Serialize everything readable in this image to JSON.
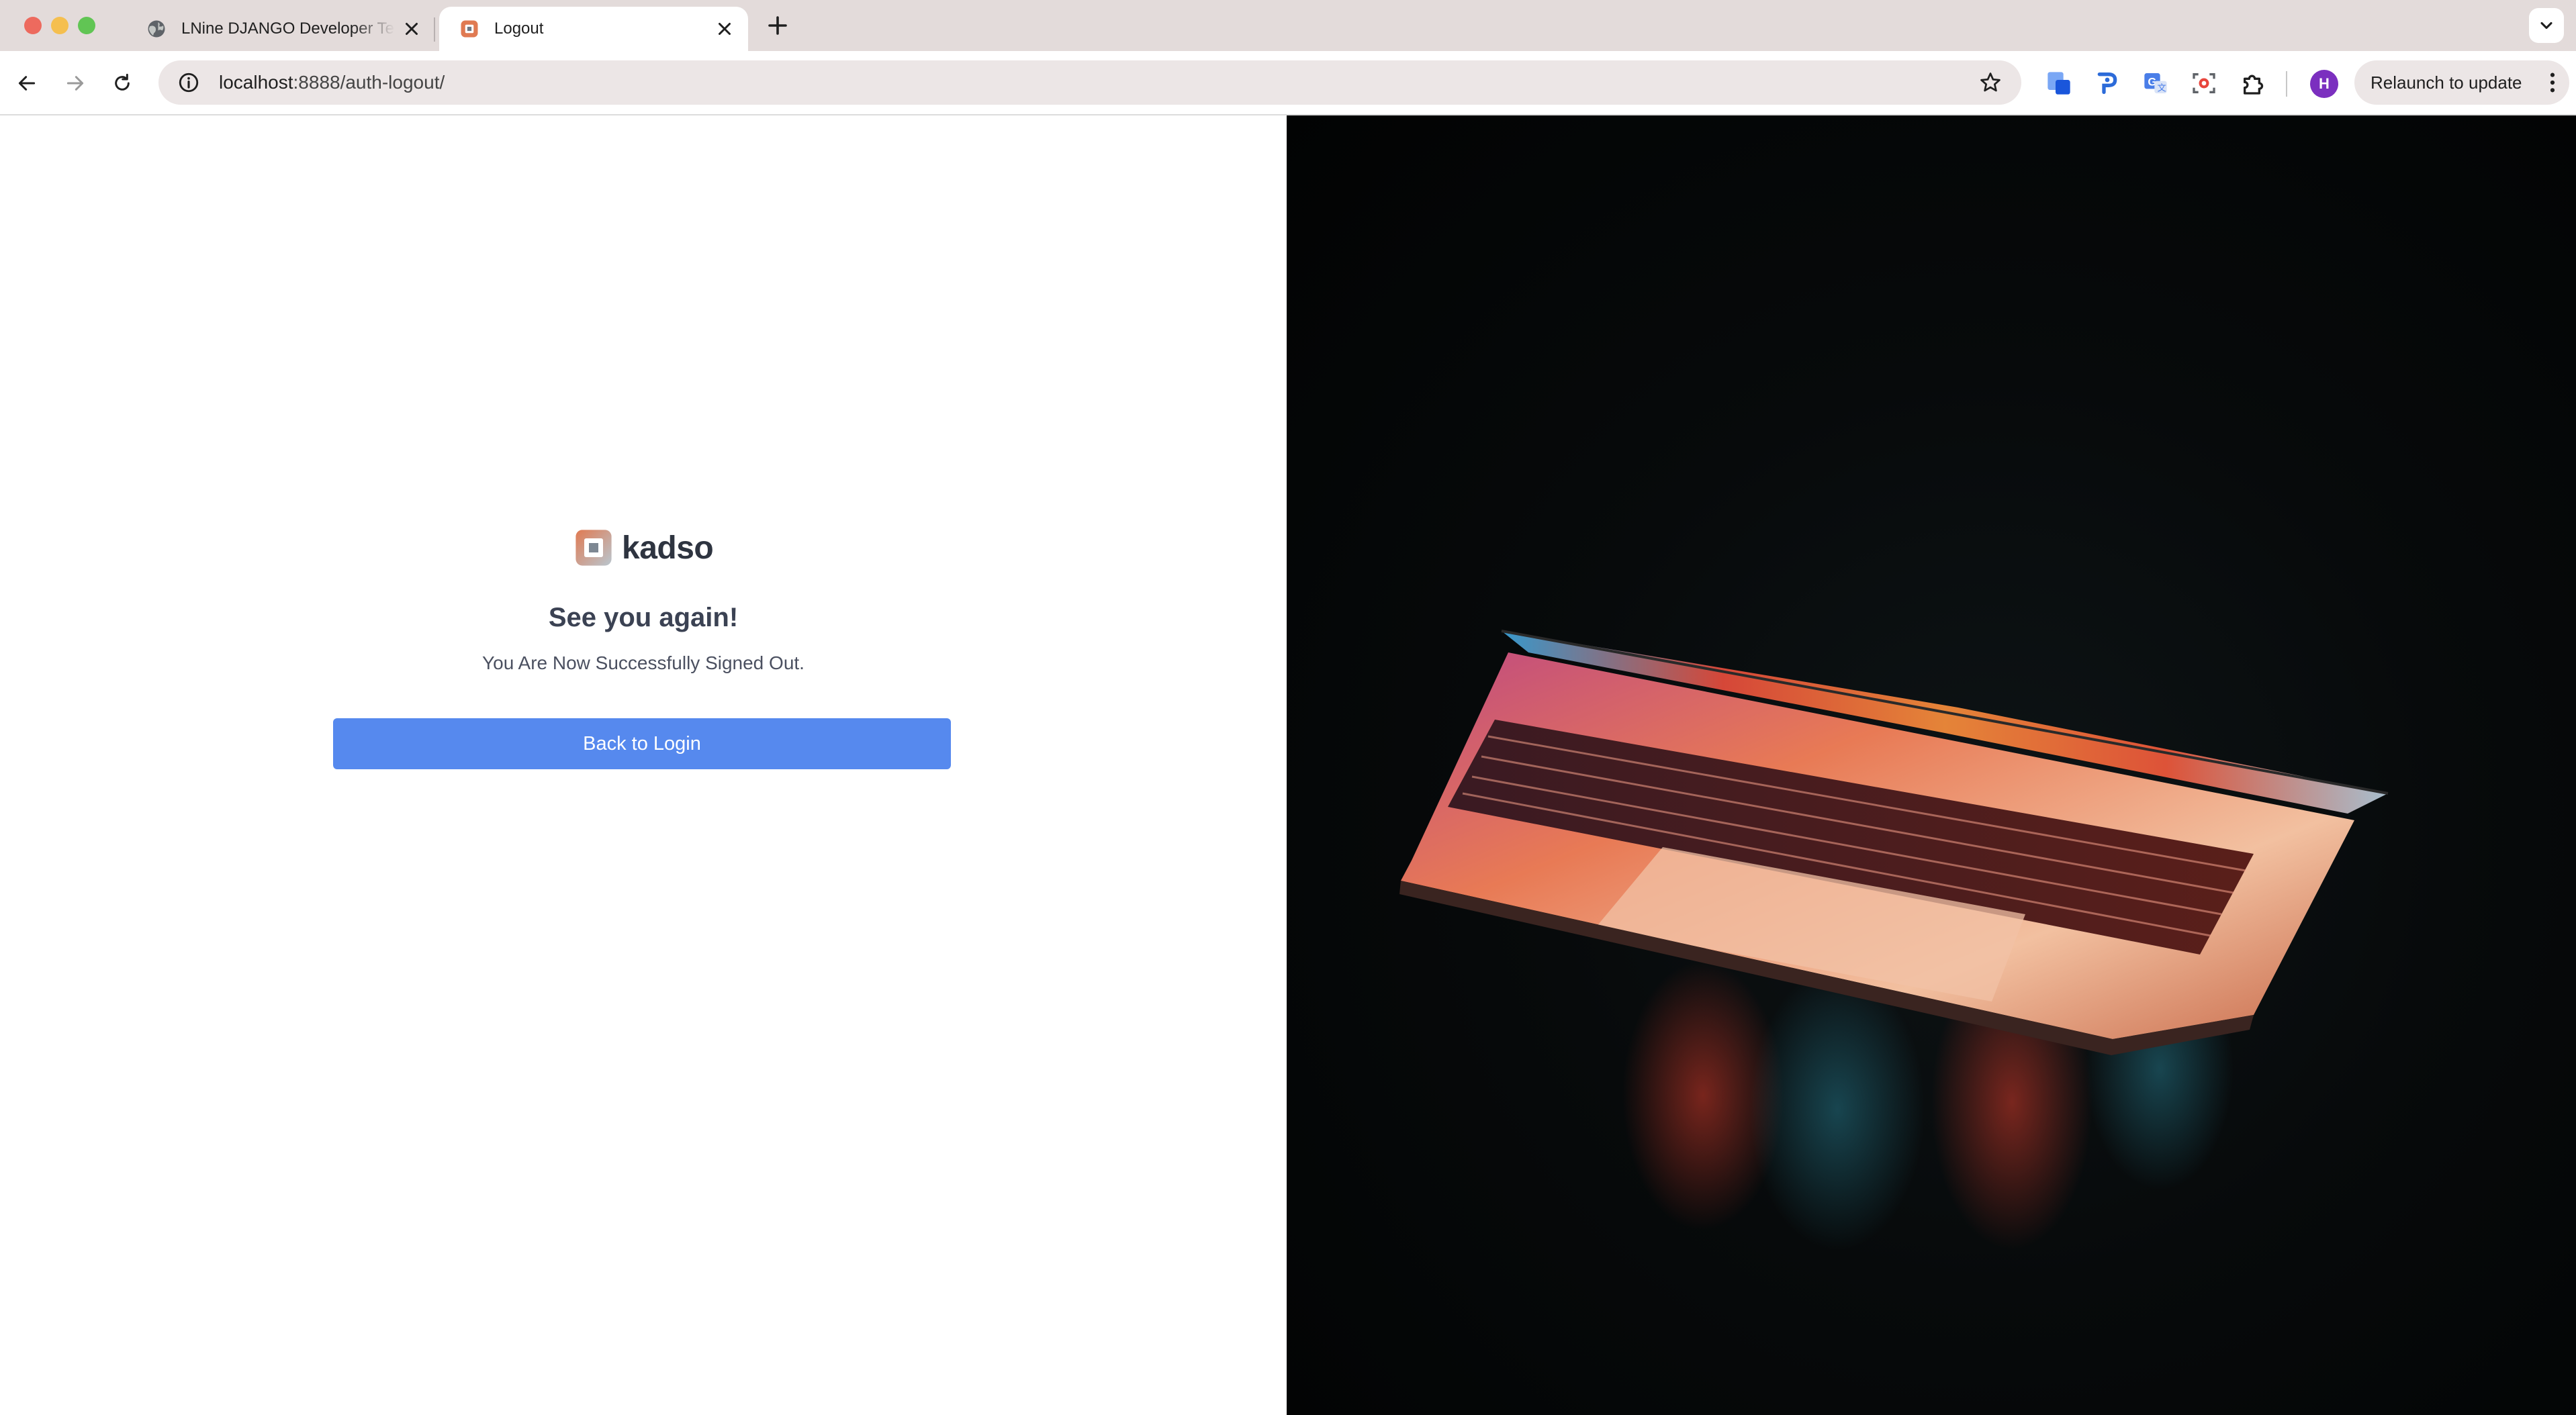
{
  "browser": {
    "tabs": [
      {
        "title": "LNine DJANGO Developer Team",
        "favicon": "globe-icon",
        "active": false
      },
      {
        "title": "Logout",
        "favicon": "kadso-favicon",
        "active": true
      }
    ],
    "url_host": "localhost",
    "url_rest": ":8888/auth-logout/",
    "profile_initial": "H",
    "relaunch_label": "Relaunch to update",
    "extensions": [
      "docs-extension-icon",
      "pen-extension-icon",
      "translate-extension-icon",
      "screenshot-extension-icon",
      "puzzle-extensions-icon"
    ]
  },
  "page": {
    "brand_name": "kadso",
    "heading": "See you again!",
    "message": "You Are Now Successfully Signed Out.",
    "back_button_label": "Back to Login",
    "colors": {
      "primary_button": "#5689ee",
      "heading_text": "#3b4253",
      "logo_accent": "#e07a52"
    },
    "hero_image": "laptop-glowing-keyboard-dark-photo"
  }
}
